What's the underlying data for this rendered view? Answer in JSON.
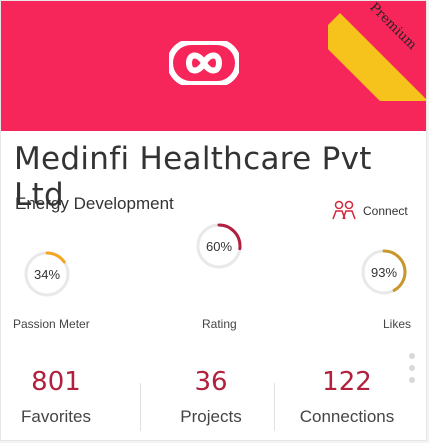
{
  "ribbon": {
    "label": "Premium"
  },
  "company": {
    "name": "Medinfi Healthcare Pvt Ltd",
    "department": "Energy Development"
  },
  "connect": {
    "label": "Connect"
  },
  "meters": [
    {
      "value": "34%",
      "percent": 34,
      "label": "Passion Meter",
      "color": "#f5a524"
    },
    {
      "value": "60%",
      "percent": 60,
      "label": "Rating",
      "color": "#b1203d"
    },
    {
      "value": "93%",
      "percent": 93,
      "label": "Likes",
      "color": "#c9962a"
    }
  ],
  "stats": [
    {
      "number": "801",
      "label": "Favorites"
    },
    {
      "number": "36",
      "label": "Projects"
    },
    {
      "number": "122",
      "label": "Connections"
    }
  ],
  "colors": {
    "hero": "#f7265a",
    "accent": "#b1203d",
    "ribbon": "#f6c21c"
  }
}
